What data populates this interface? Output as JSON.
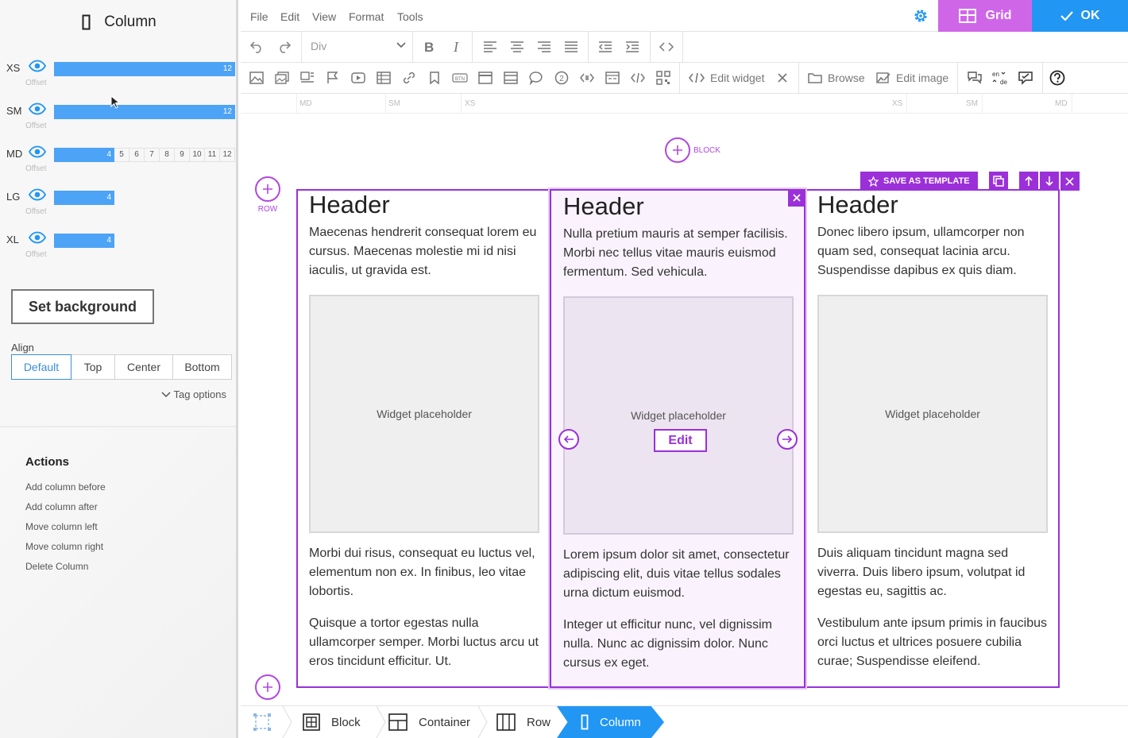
{
  "sidebar": {
    "title": "Column",
    "breakpoints": [
      {
        "label": "XS",
        "offset_label": "Offset",
        "value": 12,
        "max": 12
      },
      {
        "label": "SM",
        "offset_label": "Offset",
        "value": 12,
        "max": 12
      },
      {
        "label": "MD",
        "offset_label": "Offset",
        "value": 4,
        "max": 12,
        "ticks": [
          "5",
          "6",
          "7",
          "8",
          "9",
          "10",
          "11",
          "12"
        ]
      },
      {
        "label": "LG",
        "offset_label": "Offset",
        "value": 4,
        "max": 12
      },
      {
        "label": "XL",
        "offset_label": "Offset",
        "value": 4,
        "max": 12
      }
    ],
    "set_background": "Set background",
    "align_label": "Align",
    "align_options": [
      "Default",
      "Top",
      "Center",
      "Bottom"
    ],
    "align_selected": "Default",
    "tag_options": "Tag options",
    "actions_title": "Actions",
    "actions": [
      "Add column before",
      "Add column after",
      "Move column left",
      "Move column right",
      "Delete Column"
    ]
  },
  "menu": [
    "File",
    "Edit",
    "View",
    "Format",
    "Tools"
  ],
  "header_buttons": {
    "grid": "Grid",
    "ok": "OK"
  },
  "toolbar": {
    "block_format": "Div",
    "edit_widget": "Edit widget",
    "browse": "Browse",
    "edit_image": "Edit image",
    "lang_top": "en",
    "lang_bottom": "de",
    "btn_label": "BTN"
  },
  "ruler": {
    "left": [
      "MD",
      "SM",
      "XS"
    ],
    "right": [
      "XS",
      "SM",
      "MD"
    ]
  },
  "canvas": {
    "add_block": "BLOCK",
    "add_row": "ROW",
    "save_template": "SAVE AS TEMPLATE",
    "columns": [
      {
        "header": "Header",
        "p1": "Maecenas hendrerit consequat lorem eu cursus. Maecenas molestie mi id nisi iaculis, ut gravida est.",
        "widget": "Widget placeholder",
        "p2": "Morbi dui risus, consequat eu luctus vel, elementum non ex. In finibus, leo vitae lobortis.",
        "p3": "Quisque a tortor egestas nulla ullamcorper semper. Morbi luctus arcu ut eros tincidunt efficitur. Ut."
      },
      {
        "header": "Header",
        "p1": "Nulla pretium mauris at semper facilisis. Morbi nec tellus vitae mauris euismod fermentum. Sed vehicula.",
        "widget": "Widget placeholder",
        "edit": "Edit",
        "p2": "Lorem ipsum dolor sit amet, consectetur adipiscing elit, duis vitae tellus sodales urna dictum euismod.",
        "p3": "Integer ut efficitur nunc, vel dignissim nulla. Nunc ac dignissim dolor. Nunc cursus ex eget."
      },
      {
        "header": "Header",
        "p1": "Donec libero ipsum, ullamcorper non quam sed, consequat lacinia arcu. Suspendisse dapibus ex quis diam.",
        "widget": "Widget placeholder",
        "p2": "Duis aliquam tincidunt magna sed viverra. Duis libero ipsum, volutpat id egestas eu, sagittis ac.",
        "p3": "Vestibulum ante ipsum primis in faucibus orci luctus et ultrices posuere cubilia curae; Suspendisse eleifend."
      }
    ]
  },
  "breadcrumb": [
    "Block",
    "Container",
    "Row",
    "Column"
  ],
  "colors": {
    "accent_purple": "#9b30d9",
    "grid_button": "#cf66e8",
    "primary_blue": "#2196f3",
    "breakpoint_bar": "#4da3f5"
  }
}
